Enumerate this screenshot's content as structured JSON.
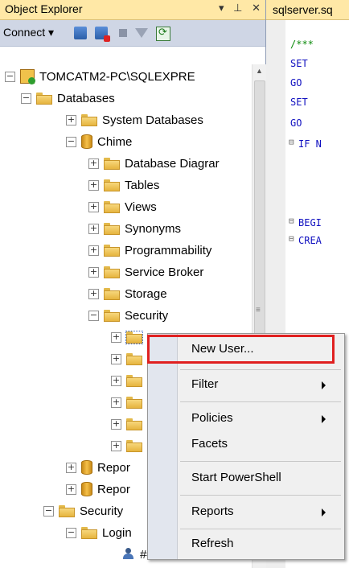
{
  "object_explorer": {
    "title": "Object Explorer",
    "title_controls": [
      "▾",
      "⊥",
      "✕"
    ],
    "toolbar": {
      "connect_label": "Connect ▾"
    }
  },
  "editor": {
    "tab_label": "sqlserver.sq",
    "lines": [
      "/***",
      "SET",
      "GO",
      "SET",
      "GO",
      "IF N",
      "BEGI",
      "CREA"
    ]
  },
  "tree": {
    "server": "TOMCATM2-PC\\SQLEXPRE",
    "databases": "Databases",
    "system_databases": "System Databases",
    "chime": "Chime",
    "database_diagrams": "Database Diagrar",
    "tables": "Tables",
    "views": "Views",
    "synonyms": "Synonyms",
    "programmability": "Programmability",
    "service_broker": "Service Broker",
    "storage": "Storage",
    "security": "Security",
    "repor1": "Repor",
    "repor2": "Repor",
    "security_root": "Security",
    "logins": "Login",
    "login_item": "##"
  },
  "context_menu": {
    "items": [
      "New User...",
      "Filter",
      "Policies",
      "Facets",
      "Start PowerShell",
      "Reports",
      "Refresh"
    ]
  },
  "colors": {
    "accent_highlight": "#e02020",
    "title_bar": "#ffe8a6",
    "toolbar": "#cfd6e5"
  }
}
